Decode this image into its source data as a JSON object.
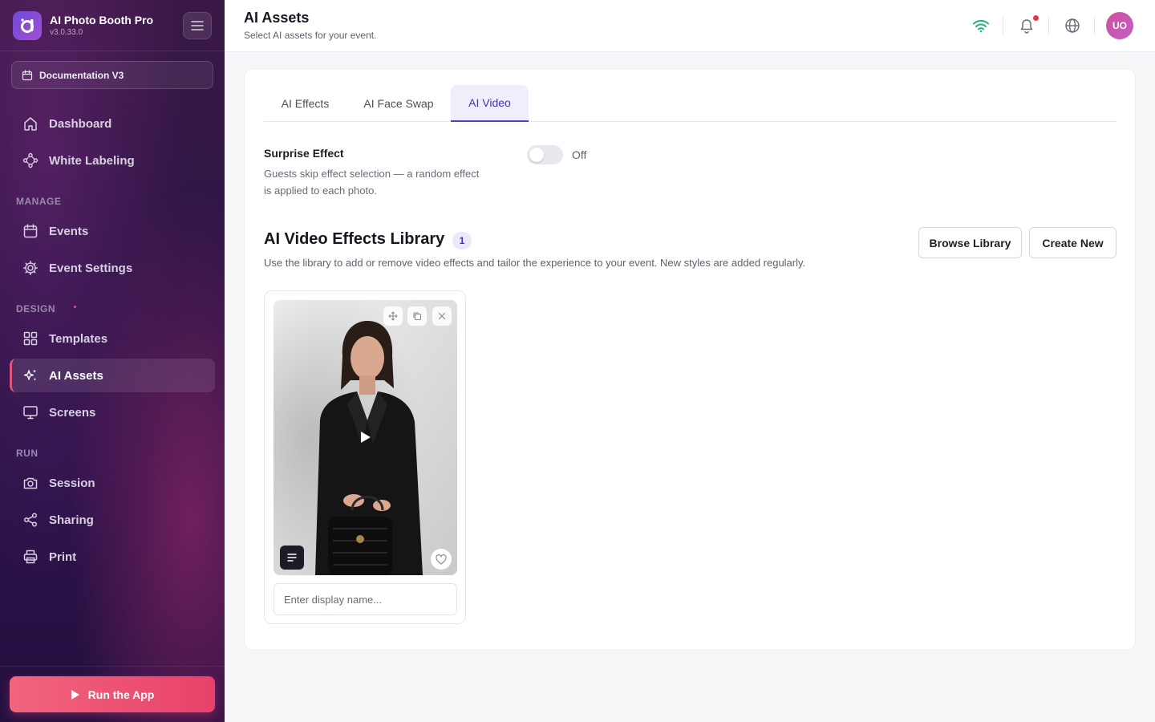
{
  "app": {
    "name": "AI Photo Booth Pro",
    "version": "v3.0.33.0"
  },
  "event_selector": {
    "label": "Documentation V3"
  },
  "sidebar": {
    "top_items": [
      {
        "label": "Dashboard",
        "icon": "home-icon"
      },
      {
        "label": "White Labeling",
        "icon": "diamond-nodes-icon"
      }
    ],
    "sections": {
      "manage": "MANAGE",
      "design": "DESIGN",
      "run": "RUN"
    },
    "manage_items": [
      {
        "label": "Events",
        "icon": "calendar-icon"
      },
      {
        "label": "Event Settings",
        "icon": "gear-icon"
      }
    ],
    "design_items": [
      {
        "label": "Templates",
        "icon": "grid-icon"
      },
      {
        "label": "AI Assets",
        "icon": "sparkles-icon",
        "active": true
      },
      {
        "label": "Screens",
        "icon": "monitor-icon"
      }
    ],
    "run_items": [
      {
        "label": "Session",
        "icon": "camera-icon"
      },
      {
        "label": "Sharing",
        "icon": "share-icon"
      },
      {
        "label": "Print",
        "icon": "printer-icon"
      }
    ],
    "run_button": "Run the App"
  },
  "header": {
    "title": "AI Assets",
    "subtitle": "Select AI assets for your event.",
    "avatar_initials": "UO",
    "colors": {
      "wifi": "#22b573",
      "notification_dot": "#e53454"
    }
  },
  "tabs": [
    {
      "label": "AI Effects",
      "active": false
    },
    {
      "label": "AI Face Swap",
      "active": false
    },
    {
      "label": "AI Video",
      "active": true
    }
  ],
  "surprise_effect": {
    "title": "Surprise Effect",
    "description": "Guests skip effect selection — a random effect is applied to each photo.",
    "toggle_state": "Off",
    "enabled": false
  },
  "library": {
    "title": "AI Video Effects Library",
    "count": "1",
    "description": "Use the library to add or remove video effects and tailor the experience to your event. New styles are added regularly.",
    "browse_button": "Browse Library",
    "create_button": "Create New"
  },
  "asset_card": {
    "name_placeholder": "Enter display name...",
    "name_value": ""
  },
  "colors": {
    "accent": "#5b3ec8",
    "run_button": "#e8416a",
    "sidebar_bg": "#2b1446"
  }
}
